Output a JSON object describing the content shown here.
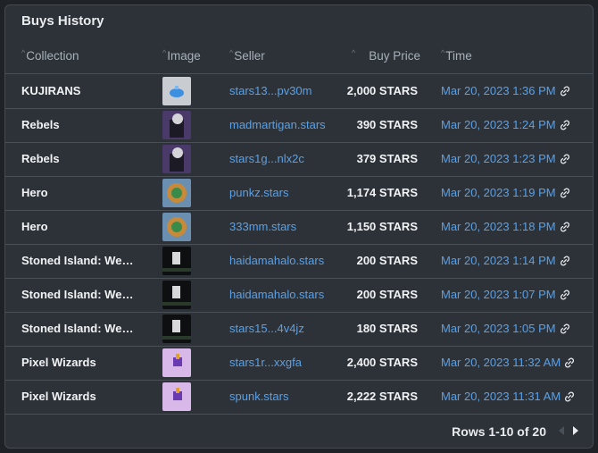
{
  "title": "Buys History",
  "columns": {
    "collection": "Collection",
    "image": "Image",
    "seller": "Seller",
    "price": "Buy Price",
    "time": "Time"
  },
  "rows": [
    {
      "collection": "KUJIRANS",
      "image": "kujirans-thumbnail",
      "seller": "stars13...pv30m",
      "price": "2,000 STARS",
      "time": "Mar 20, 2023 1:36 PM"
    },
    {
      "collection": "Rebels",
      "image": "rebels-thumbnail",
      "seller": "madmartigan.stars",
      "price": "390 STARS",
      "time": "Mar 20, 2023 1:24 PM"
    },
    {
      "collection": "Rebels",
      "image": "rebels-thumbnail",
      "seller": "stars1g...nlx2c",
      "price": "379 STARS",
      "time": "Mar 20, 2023 1:23 PM"
    },
    {
      "collection": "Hero",
      "image": "hero-thumbnail",
      "seller": "punkz.stars",
      "price": "1,174 STARS",
      "time": "Mar 20, 2023 1:19 PM"
    },
    {
      "collection": "Hero",
      "image": "hero-thumbnail",
      "seller": "333mm.stars",
      "price": "1,150 STARS",
      "time": "Mar 20, 2023 1:18 PM"
    },
    {
      "collection": "Stoned Island: Weed ...",
      "image": "stoned-island-thumbnail",
      "seller": "haidamahalo.stars",
      "price": "200 STARS",
      "time": "Mar 20, 2023 1:14 PM"
    },
    {
      "collection": "Stoned Island: Weed ...",
      "image": "stoned-island-thumbnail",
      "seller": "haidamahalo.stars",
      "price": "200 STARS",
      "time": "Mar 20, 2023 1:07 PM"
    },
    {
      "collection": "Stoned Island: Weed ...",
      "image": "stoned-island-thumbnail",
      "seller": "stars15...4v4jz",
      "price": "180 STARS",
      "time": "Mar 20, 2023 1:05 PM"
    },
    {
      "collection": "Pixel Wizards",
      "image": "pixel-wizards-thumbnail",
      "seller": "stars1r...xxgfa",
      "price": "2,400 STARS",
      "time": "Mar 20, 2023 11:32 AM"
    },
    {
      "collection": "Pixel Wizards",
      "image": "pixel-wizards-thumbnail",
      "seller": "spunk.stars",
      "price": "2,222 STARS",
      "time": "Mar 20, 2023 11:31 AM"
    }
  ],
  "pagination": {
    "label": "Rows 1-10 of 20"
  },
  "colors": {
    "link": "#5aa0e6",
    "background": "#2d3238"
  }
}
